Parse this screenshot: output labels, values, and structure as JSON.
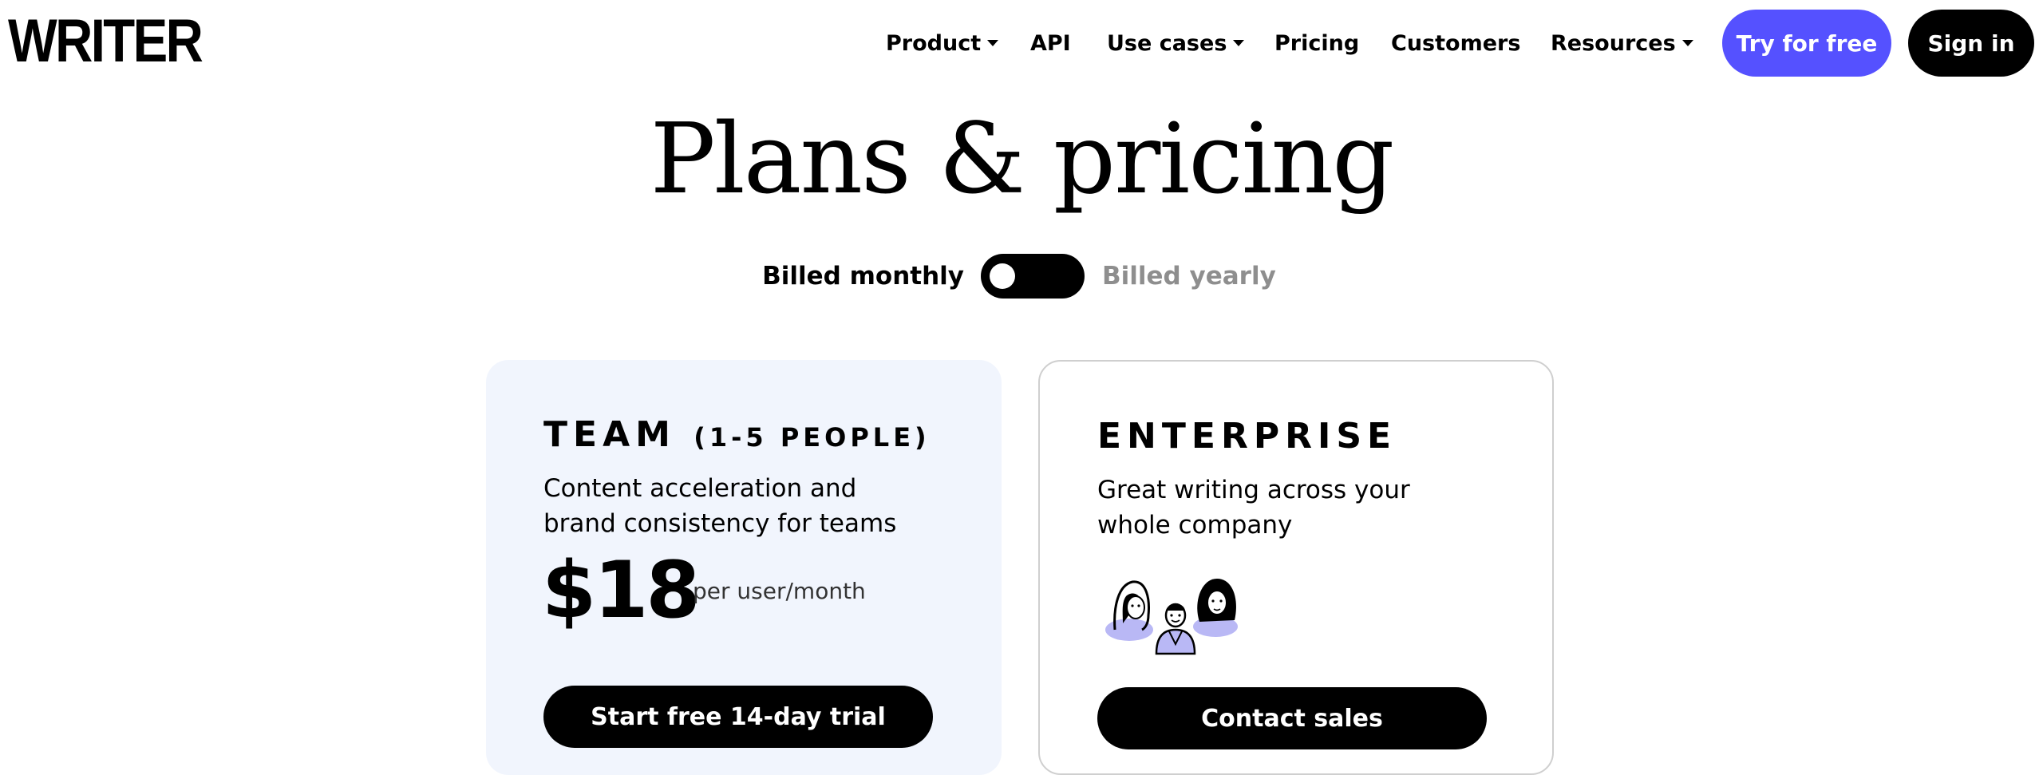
{
  "header": {
    "logo_text": "WRITER",
    "nav": [
      {
        "label": "Product",
        "has_dropdown": true
      },
      {
        "label": "API",
        "has_dropdown": false
      },
      {
        "label": "Use cases",
        "has_dropdown": true
      },
      {
        "label": "Pricing",
        "has_dropdown": false
      },
      {
        "label": "Customers",
        "has_dropdown": false
      },
      {
        "label": "Resources",
        "has_dropdown": true
      }
    ],
    "try_label": "Try for free",
    "signin_label": "Sign in"
  },
  "page": {
    "title": "Plans & pricing",
    "billing": {
      "monthly_label": "Billed monthly",
      "yearly_label": "Billed yearly",
      "selected": "monthly"
    }
  },
  "plans": [
    {
      "name": "TEAM",
      "name_sub": "(1-5 PEOPLE)",
      "description": "Content acceleration and brand consistency for teams",
      "price": "$18",
      "price_unit": "per user/month",
      "cta": "Start free 14-day trial"
    },
    {
      "name": "ENTERPRISE",
      "description": "Great writing across your whole company",
      "cta": "Contact sales"
    }
  ],
  "colors": {
    "accent": "#5551ff",
    "team_card_bg": "#f1f5fd",
    "illustration_accent": "#b9b8f5"
  }
}
